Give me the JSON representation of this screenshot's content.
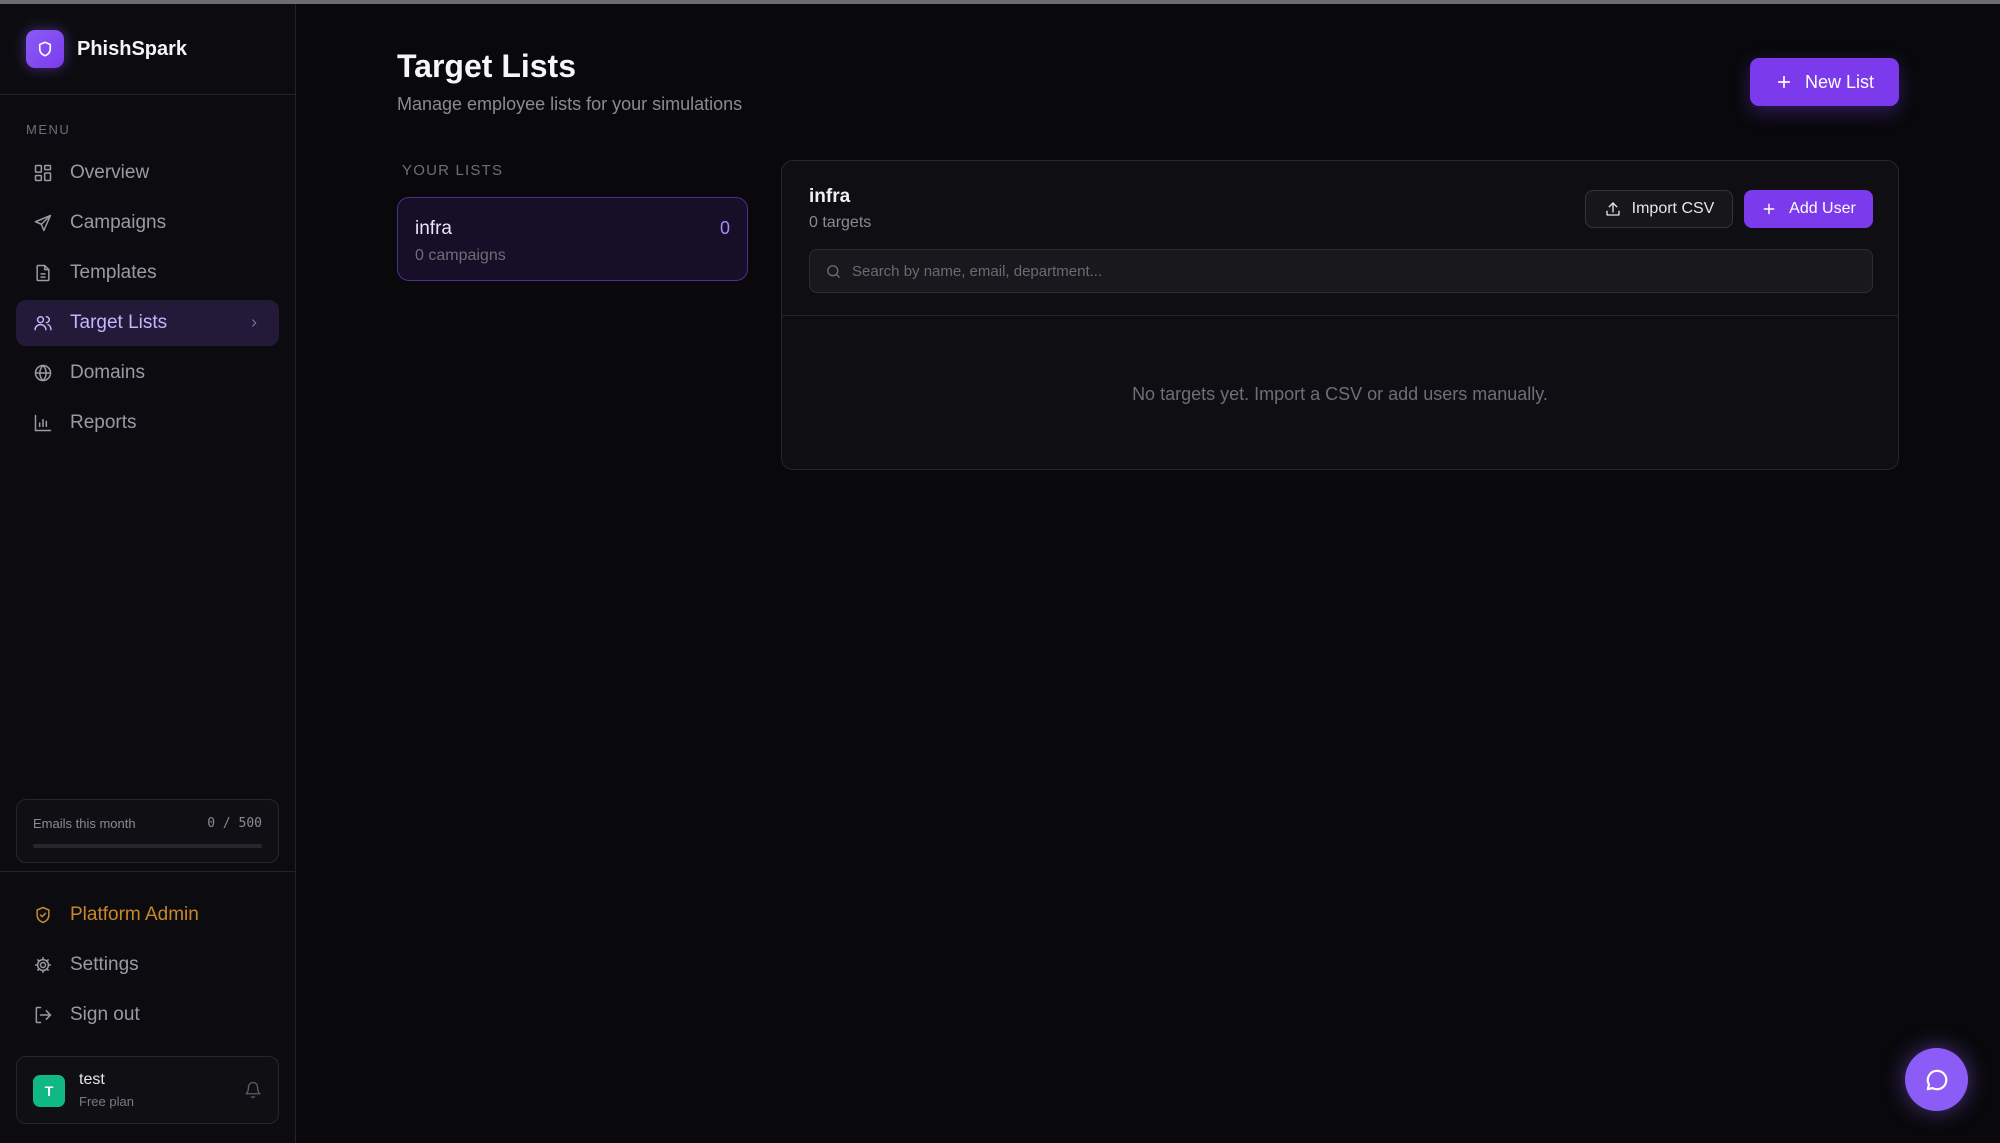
{
  "app": {
    "name": "PhishSpark"
  },
  "sidebar": {
    "menu_label": "MENU",
    "items": [
      {
        "label": "Overview",
        "icon": "grid-icon"
      },
      {
        "label": "Campaigns",
        "icon": "send-icon"
      },
      {
        "label": "Templates",
        "icon": "file-text-icon"
      },
      {
        "label": "Target Lists",
        "icon": "users-icon",
        "active": true
      },
      {
        "label": "Domains",
        "icon": "globe-icon"
      },
      {
        "label": "Reports",
        "icon": "bar-chart-icon"
      }
    ],
    "usage": {
      "label": "Emails this month",
      "count": "0 / 500",
      "progress_percent": 0
    },
    "bottom_items": [
      {
        "label": "Platform Admin",
        "icon": "shield-check-icon"
      },
      {
        "label": "Settings",
        "icon": "gear-icon"
      },
      {
        "label": "Sign out",
        "icon": "logout-icon"
      }
    ],
    "user": {
      "initial": "T",
      "name": "test",
      "plan": "Free plan"
    }
  },
  "header": {
    "title": "Target Lists",
    "subtitle": "Manage employee lists for your simulations",
    "new_list_label": "New List"
  },
  "lists": {
    "section_label": "YOUR LISTS",
    "items": [
      {
        "name": "infra",
        "count": "0",
        "campaigns": "0 campaigns"
      }
    ]
  },
  "detail": {
    "title": "infra",
    "subtitle": "0 targets",
    "import_label": "Import CSV",
    "add_user_label": "Add User",
    "search_placeholder": "Search by name, email, department...",
    "empty_text": "No targets yet. Import a CSV or add users manually."
  },
  "colors": {
    "accent": "#7c3aed",
    "accent_light": "#8b5cf6",
    "active_nav_bg": "#221a38",
    "admin": "#c7872a",
    "avatar": "#10b981",
    "background": "#09090c"
  }
}
